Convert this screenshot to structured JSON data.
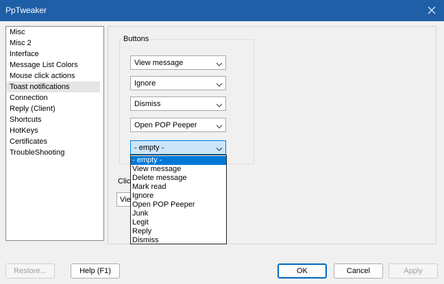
{
  "window": {
    "title": "PpTweaker"
  },
  "nav": {
    "items": [
      "Misc",
      "Misc 2",
      "Interface",
      "Message List Colors",
      "Mouse click actions",
      "Toast notifications",
      "Connection",
      "Reply (Client)",
      "Shortcuts",
      "HotKeys",
      "Certificates",
      "TroubleShooting"
    ],
    "selected": "Toast notifications"
  },
  "buttons_group": {
    "label": "Buttons",
    "combos": [
      "View message",
      "Ignore",
      "Dismiss",
      "Open POP Peeper",
      "- empty -"
    ]
  },
  "dropdown": {
    "options": [
      "- empty -",
      "View message",
      "Delete message",
      "Mark read",
      "Ignore",
      "Open POP Peeper",
      "Junk",
      "Legit",
      "Reply",
      "Dismiss"
    ],
    "selected": "- empty -"
  },
  "click_section": {
    "label": "Click",
    "combo_value": "View message"
  },
  "footer": {
    "restore": "Restore...",
    "help": "Help (F1)",
    "ok": "OK",
    "cancel": "Cancel",
    "apply": "Apply"
  },
  "colors": {
    "titlebar": "#1f5fa8",
    "selection": "#0078d7",
    "open_combo": "#cce4f7"
  }
}
